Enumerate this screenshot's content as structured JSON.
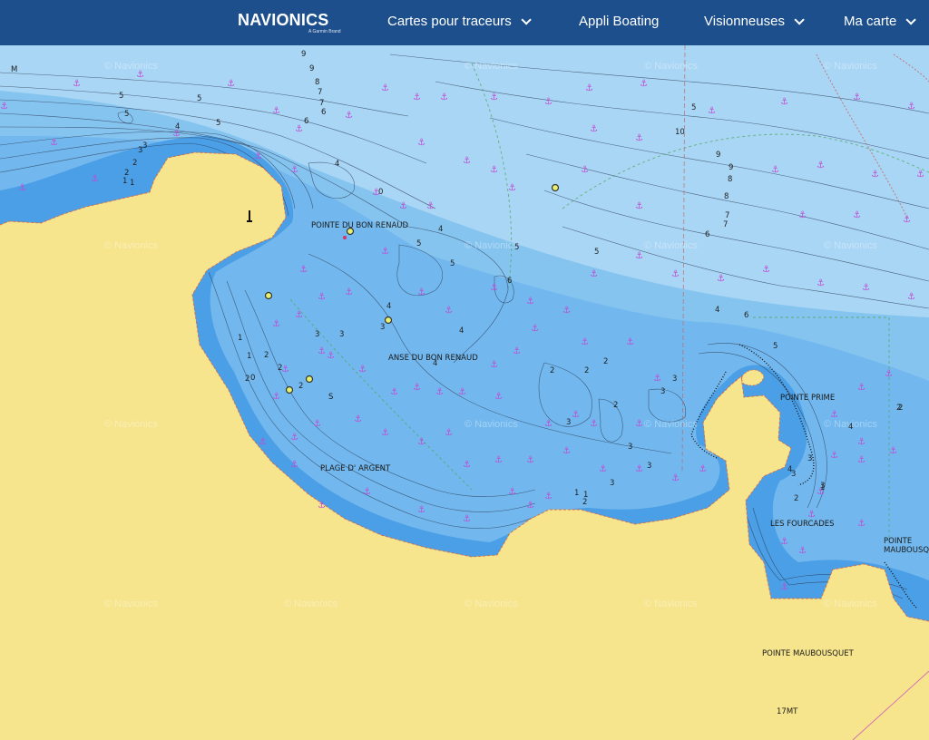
{
  "header": {
    "logo": "NAVIONICS",
    "logo_sub": "A Garmin Brand",
    "nav": [
      {
        "label": "Cartes pour traceurs",
        "dropdown": true
      },
      {
        "label": "Appli Boating",
        "dropdown": false
      },
      {
        "label": "Visionneuses",
        "dropdown": true
      },
      {
        "label": "Ma carte",
        "dropdown": true
      }
    ]
  },
  "map": {
    "place_labels": {
      "pointe_bon_renaud": "POINTE DU BON RENAUD",
      "anse_bon_renaud": "ANSE DU BON RENAUD",
      "plage_argent": "PLAGE D' ARGENT",
      "pointe_prime": "POINTE PRIME",
      "les_fourcades": "LES FOURCADES",
      "pointe_maubousquet_1": "POINTE",
      "pointe_maubousquet_2": "MAUBOUSQU",
      "pointe_maubousquet_land": "POINTE MAUBOUSQUET",
      "mt17": "17MT",
      "seabed_m": "M",
      "seabed_s": "S"
    },
    "watermark": "© Navionics",
    "colors": {
      "land": "#f6e58d",
      "deep": "#a9d6f5",
      "mid": "#7fc0ef",
      "shallow": "#4a9fe6",
      "header": "#1c4f8c",
      "anchorage": "#c04bd6"
    },
    "soundings": [
      "9",
      "9",
      "8",
      "7",
      "7",
      "6",
      "6",
      "5",
      "5",
      "5",
      "5",
      "4",
      "3",
      "3",
      "2",
      "2",
      "1",
      "1",
      "0",
      "4",
      "4",
      "5",
      "5",
      "5",
      "5",
      "6",
      "4",
      "4",
      "4",
      "3",
      "3",
      "3",
      "2",
      "2",
      "2",
      "2",
      "1",
      "1",
      "0",
      "2",
      "2",
      "2",
      "2",
      "3",
      "3",
      "3",
      "3",
      "3",
      "3",
      "1",
      "1",
      "2",
      "2",
      "3",
      "4",
      "5",
      "10",
      "9",
      "9",
      "8",
      "8",
      "7",
      "7",
      "6",
      "6",
      "4",
      "5",
      "4",
      "3",
      "3",
      "2",
      "1",
      "2",
      "5"
    ]
  }
}
